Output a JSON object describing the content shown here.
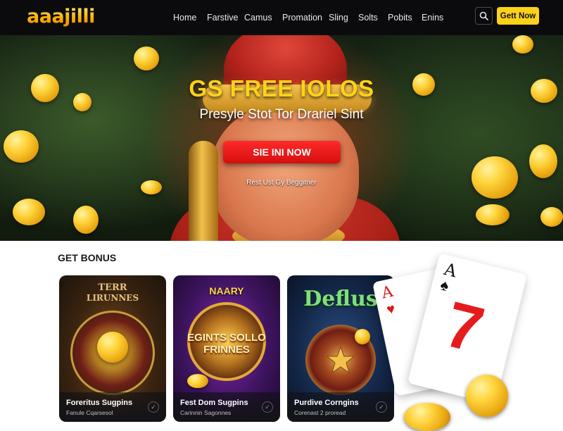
{
  "header": {
    "logo": "aaajilli",
    "nav": [
      "Home",
      "Farstive",
      "Camus",
      "Promation",
      "Sling",
      "Solts",
      "Pobits",
      "Enins"
    ],
    "cta_label": "Gett Now"
  },
  "hero": {
    "title": "GS FREE IOLOS",
    "subtitle": "Presyle Stot Tor Drariel Sint",
    "button_label": "SIE INI NOW",
    "note": "Rest Ust Gy Beggitner"
  },
  "bonus": {
    "title": "GET BONUS",
    "cards": [
      {
        "art_text_1": "TERR",
        "art_text_2": "LIRUNNES",
        "title": "Foreritus Sugpins",
        "subtitle": "Fanule Cqarsesol"
      },
      {
        "art_text_1": "NAARY",
        "art_text_2": "EGINTS SOLLO FRINNES",
        "title": "Fest Dom Sugpins",
        "subtitle": "Carinnin Sagonnes"
      },
      {
        "art_text_1": "Deflus",
        "art_text_2": "",
        "title": "Purdive Corngins",
        "subtitle": "Corenast 2 proread"
      }
    ]
  },
  "playing_cards": {
    "back_rank": "A",
    "back_suit": "♥",
    "front_rank": "A",
    "front_suit": "♠",
    "front_number": "7"
  },
  "colors": {
    "accent_yellow": "#ffd21a",
    "cta_red": "#e01414",
    "nav_bg": "#0b0b0d"
  },
  "icons": {
    "search": "search-icon",
    "card_check": "check-icon"
  }
}
